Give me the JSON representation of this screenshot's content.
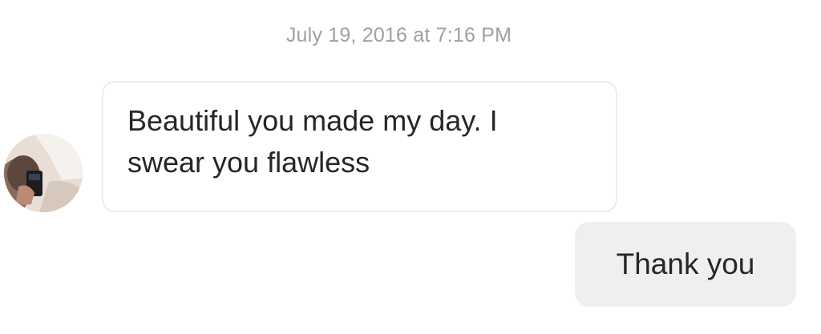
{
  "thread": {
    "timestamp": "July 19, 2016 at 7:16 PM",
    "messages": [
      {
        "sender": "other",
        "lines": [
          "Beautiful you made my day. I",
          "swear you flawless"
        ]
      },
      {
        "sender": "me",
        "text": "Thank you"
      }
    ]
  },
  "icons": {
    "avatar": "profile-photo-avatar"
  }
}
